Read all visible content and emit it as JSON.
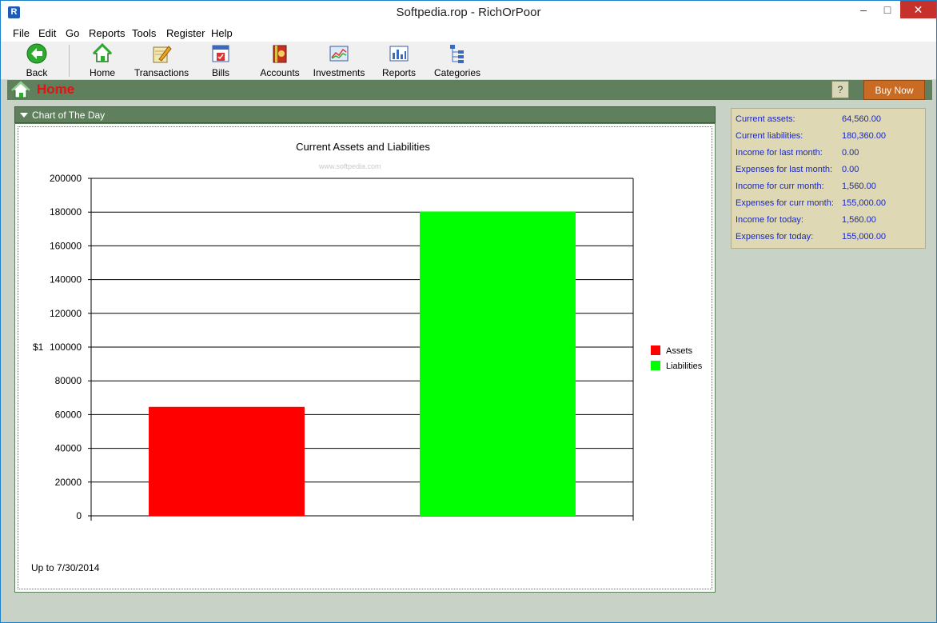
{
  "window": {
    "title": "Softpedia.rop - RichOrPoor",
    "app_icon_letter": "R",
    "minimize": "–",
    "maximize": "□",
    "close": "✕"
  },
  "menu": [
    "File",
    "Edit",
    "Go",
    "Reports",
    "Tools",
    "Register",
    "Help"
  ],
  "toolbar": {
    "back": "Back",
    "home": "Home",
    "transactions": "Transactions",
    "bills": "Bills",
    "accounts": "Accounts",
    "investments": "Investments",
    "reports": "Reports",
    "categories": "Categories"
  },
  "homebar": {
    "title": "Home",
    "help_label": "?",
    "buy_now_label": "Buy Now"
  },
  "chart_panel": {
    "header": "Chart of The Day",
    "watermark": "www.softpedia.com",
    "footer": "Up to 7/30/2014"
  },
  "chart_data": {
    "type": "bar",
    "title": "Current Assets and Liabilities",
    "ylabel": "$1",
    "xlabel": "",
    "categories": [
      "Assets",
      "Liabilities"
    ],
    "values": [
      64560,
      180360
    ],
    "colors": [
      "#ff0000",
      "#00ff00"
    ],
    "ylim": [
      0,
      200000
    ],
    "yticks": [
      0,
      20000,
      40000,
      60000,
      80000,
      100000,
      120000,
      140000,
      160000,
      180000,
      200000
    ],
    "grid": true,
    "legend": "right"
  },
  "stats": [
    {
      "label": "Current assets:",
      "value": "64,560.00"
    },
    {
      "label": "Current liabilities:",
      "value": "180,360.00"
    },
    {
      "label": "Income for last month:",
      "value": "0.00"
    },
    {
      "label": "Expenses for last month:",
      "value": "0.00"
    },
    {
      "label": "Income for curr month:",
      "value": "1,560.00"
    },
    {
      "label": "Expenses for curr month:",
      "value": "155,000.00"
    },
    {
      "label": "Income for today:",
      "value": "1,560.00"
    },
    {
      "label": "Expenses for today:",
      "value": "155,000.00"
    }
  ]
}
